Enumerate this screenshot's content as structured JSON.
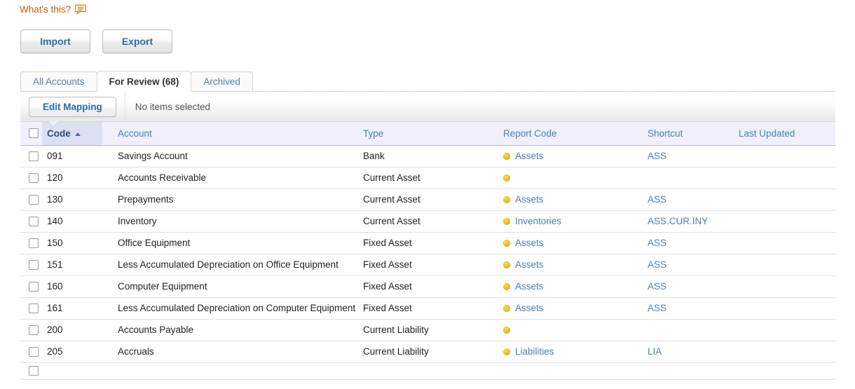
{
  "help": {
    "label": "What's this?",
    "icon": "speech-bubble-icon",
    "color": "#c4600f"
  },
  "actions": {
    "import_label": "Import",
    "export_label": "Export"
  },
  "tabs": [
    {
      "label": "All Accounts",
      "active": false
    },
    {
      "label": "For Review (68)",
      "active": true
    },
    {
      "label": "Archived",
      "active": false
    }
  ],
  "toolbar": {
    "edit_mapping_label": "Edit Mapping",
    "selection_status": "No items selected"
  },
  "table": {
    "sort_column": "Code",
    "sort_direction": "asc",
    "columns": [
      "Code",
      "Account",
      "Type",
      "Report Code",
      "Shortcut",
      "Last Updated"
    ],
    "rows": [
      {
        "code": "091",
        "account": "Savings Account",
        "type": "Bank",
        "dot": true,
        "report_code": "Assets",
        "shortcut": "ASS",
        "last_updated": ""
      },
      {
        "code": "120",
        "account": "Accounts Receivable",
        "type": "Current Asset",
        "dot": true,
        "report_code": "",
        "shortcut": "",
        "last_updated": ""
      },
      {
        "code": "130",
        "account": "Prepayments",
        "type": "Current Asset",
        "dot": true,
        "report_code": "Assets",
        "shortcut": "ASS",
        "last_updated": ""
      },
      {
        "code": "140",
        "account": "Inventory",
        "type": "Current Asset",
        "dot": true,
        "report_code": "Inventories",
        "shortcut": "ASS.CUR.INY",
        "last_updated": ""
      },
      {
        "code": "150",
        "account": "Office Equipment",
        "type": "Fixed Asset",
        "dot": true,
        "report_code": "Assets",
        "shortcut": "ASS",
        "last_updated": ""
      },
      {
        "code": "151",
        "account": "Less Accumulated Depreciation on Office Equipment",
        "type": "Fixed Asset",
        "dot": true,
        "report_code": "Assets",
        "shortcut": "ASS",
        "last_updated": ""
      },
      {
        "code": "160",
        "account": "Computer Equipment",
        "type": "Fixed Asset",
        "dot": true,
        "report_code": "Assets",
        "shortcut": "ASS",
        "last_updated": ""
      },
      {
        "code": "161",
        "account": "Less Accumulated Depreciation on Computer Equipment",
        "type": "Fixed Asset",
        "dot": true,
        "report_code": "Assets",
        "shortcut": "ASS",
        "last_updated": ""
      },
      {
        "code": "200",
        "account": "Accounts Payable",
        "type": "Current Liability",
        "dot": true,
        "report_code": "",
        "shortcut": "",
        "last_updated": ""
      },
      {
        "code": "205",
        "account": "Accruals",
        "type": "Current Liability",
        "dot": true,
        "report_code": "Liabilities",
        "shortcut": "LIA",
        "last_updated": ""
      },
      {
        "code": "",
        "account": "",
        "type": "",
        "dot": false,
        "report_code": "",
        "shortcut": "",
        "last_updated": ""
      }
    ]
  },
  "colors": {
    "link": "#4a7fb5",
    "help_link": "#c4600f",
    "header_bg": "#eff0fb",
    "sorted_header_bg": "#dde0f2",
    "dot": "#edc32c",
    "button_text": "#2b6ca3"
  }
}
